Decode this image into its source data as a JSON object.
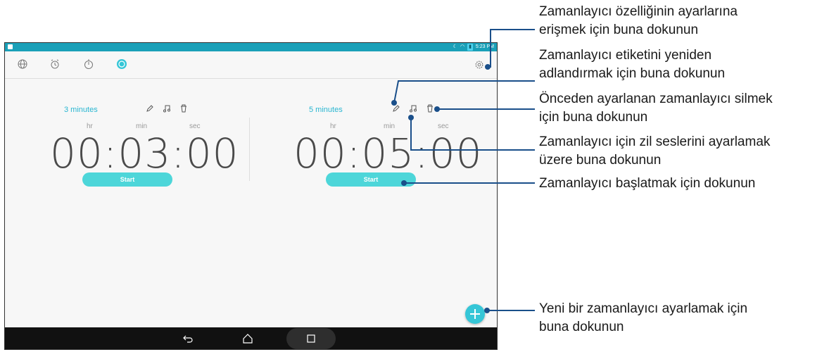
{
  "statusbar": {
    "time": "5:23 PM"
  },
  "nav": {
    "icons": [
      "globe-icon",
      "alarm-clock-icon",
      "stopwatch-icon",
      "timer-icon",
      "settings-gear-icon"
    ]
  },
  "timers": [
    {
      "label": "3 minutes",
      "hr_label": "hr",
      "min_label": "min",
      "sec_label": "sec",
      "time": "00:03:00",
      "start_label": "Start"
    },
    {
      "label": "5 minutes",
      "hr_label": "hr",
      "min_label": "min",
      "sec_label": "sec",
      "time": "00:05:00",
      "start_label": "Start"
    }
  ],
  "callouts": {
    "settings": [
      "Zamanlayıcı özelliğinin ayarlarına",
      "erişmek için buna dokunun"
    ],
    "rename": [
      "Zamanlayıcı etiketini yeniden",
      "adlandırmak için buna dokunun"
    ],
    "delete": [
      "Önceden ayarlanan zamanlayıcı silmek",
      "için buna dokunun"
    ],
    "ringtone": [
      "Zamanlayıcı için zil seslerini ayarlamak",
      "üzere buna dokunun"
    ],
    "start": [
      "Zamanlayıcı başlatmak için dokunun"
    ],
    "add": [
      "Yeni bir zamanlayıcı ayarlamak için",
      "buna dokunun"
    ]
  },
  "colors": {
    "accent": "#29b6d1",
    "start_button": "#4dd6d9",
    "statusbar": "#1aa0b8",
    "callout_line": "#1a4f8a"
  }
}
